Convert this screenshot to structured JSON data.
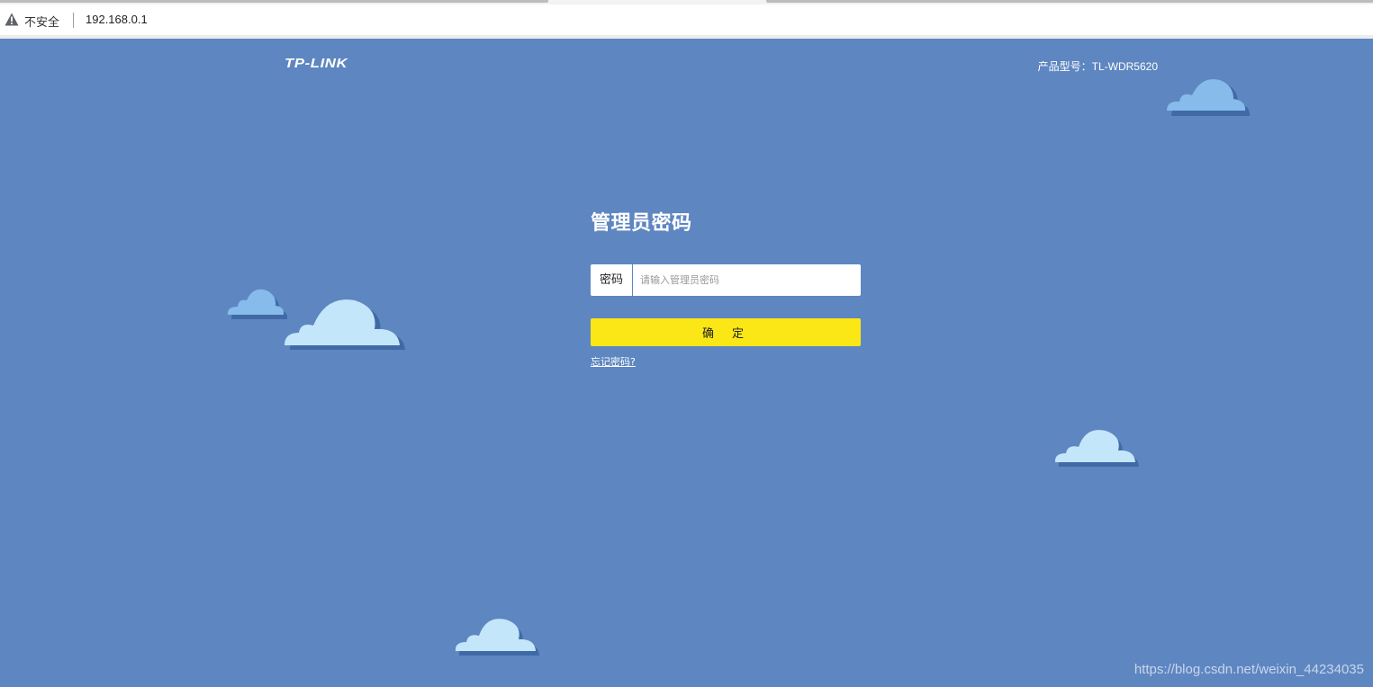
{
  "browser": {
    "security_label": "不安全",
    "url": "192.168.0.1",
    "warning_icon": "warning-triangle-icon"
  },
  "header": {
    "logo": "TP-LINK",
    "model": "产品型号：TL-WDR5620"
  },
  "login": {
    "title": "管理员密码",
    "password_label": "密码",
    "password_placeholder": "请输入管理员密码",
    "password_value": "",
    "confirm_label": "确定",
    "forgot_link": "忘记密码?"
  },
  "watermark": "https://blog.csdn.net/weixin_44234035",
  "colors": {
    "background": "#5e86c1",
    "confirm_button": "#fbe715",
    "cloud_light": "#c3e6fb",
    "cloud_mid": "#86bbec",
    "cloud_shadow": "#3f6aa6"
  }
}
